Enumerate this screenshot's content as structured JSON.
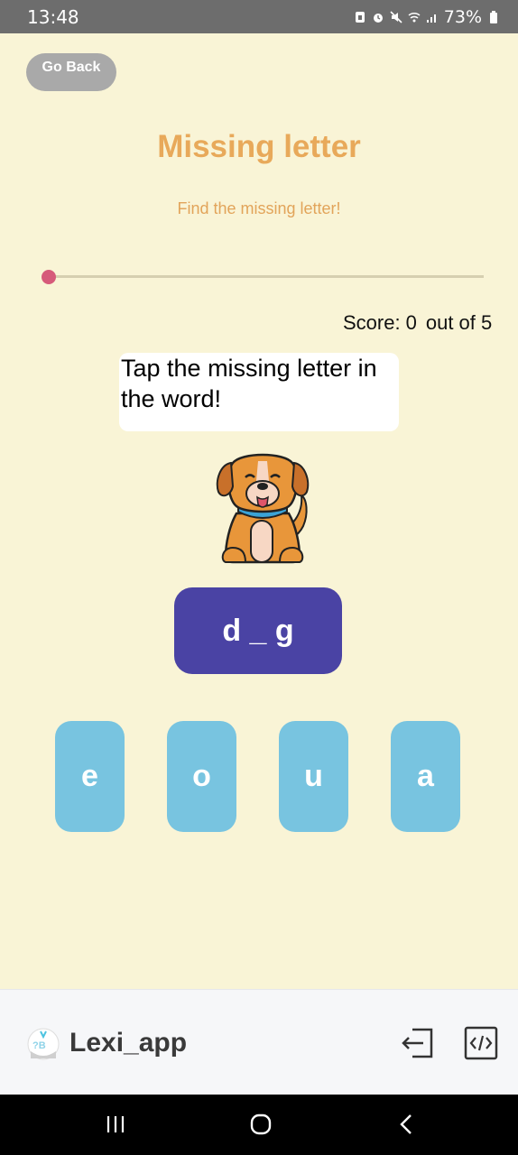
{
  "status_bar": {
    "time": "13:48",
    "battery": "73%",
    "icons": [
      "sim-card-icon",
      "alarm-icon",
      "mute-icon",
      "wifi-icon",
      "signal-icon",
      "battery-icon"
    ]
  },
  "header": {
    "back_label": "Go Back",
    "title": "Missing letter",
    "subtitle": "Find the missing letter!"
  },
  "progress": {
    "current_question": 0,
    "total": 5,
    "fraction": 0.0
  },
  "score": {
    "label": "Score:",
    "value": "0",
    "out_of": "out of 5"
  },
  "instruction": "Tap the missing letter in the word!",
  "picture": {
    "icon": "dog-icon"
  },
  "word_display": "d _ g",
  "choices": [
    "e",
    "o",
    "u",
    "a"
  ],
  "footer": {
    "app_name": "Lexi_app",
    "logo_letters": "?B",
    "actions": [
      "exit-icon",
      "code-icon"
    ]
  },
  "navigation_bar": {
    "buttons": [
      "recent-apps-icon",
      "home-icon",
      "back-icon"
    ]
  },
  "colors": {
    "background": "#f9f4d6",
    "title": "#e8a95a",
    "word_tile": "#4a43a4",
    "choice_tile": "#78c4e0",
    "slider_thumb": "#d65a7a",
    "back_button": "#a9a9a9"
  }
}
